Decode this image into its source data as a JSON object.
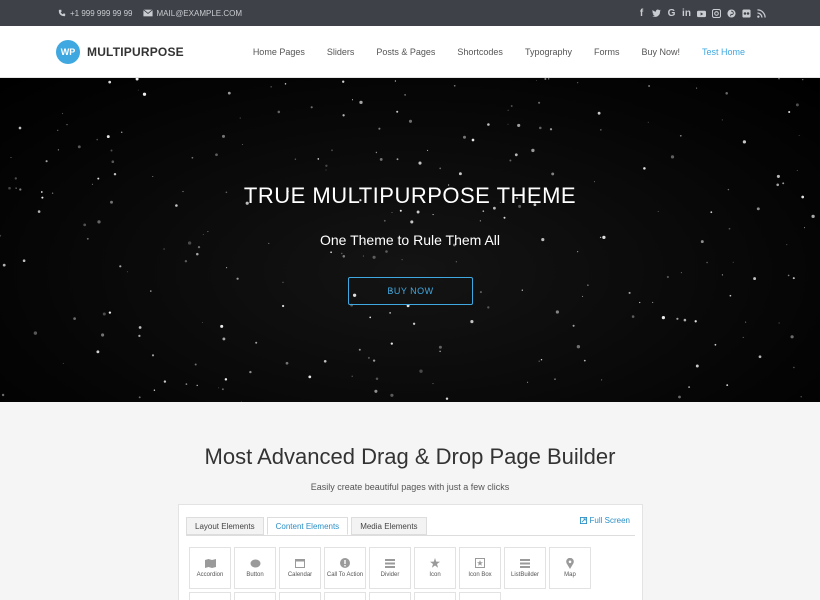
{
  "topbar": {
    "phone": "+1 999 999 99 99",
    "email": "MAIL@EXAMPLE.COM",
    "socials": [
      "facebook-icon",
      "twitter-icon",
      "google-icon",
      "linkedin-icon",
      "youtube-icon",
      "instagram-icon",
      "pinterest-icon",
      "flickr-icon",
      "rss-icon"
    ]
  },
  "header": {
    "logo_badge": "WP",
    "logo_text": "MULTIPURPOSE",
    "nav": [
      "Home Pages",
      "Sliders",
      "Posts & Pages",
      "Shortcodes",
      "Typography",
      "Forms",
      "Buy Now!",
      "Test Home"
    ],
    "active_nav": "Test Home",
    "accent": "#3fa8e0"
  },
  "hero": {
    "title": "TRUE MULTIPURPOSE THEME",
    "subtitle": "One Theme to Rule Them All",
    "button": "BUY NOW"
  },
  "section": {
    "title": "Most Advanced Drag & Drop Page Builder",
    "subtitle": "Easily create beautiful pages with just a few clicks"
  },
  "builder": {
    "tabs": [
      "Layout Elements",
      "Content Elements",
      "Media Elements"
    ],
    "active_tab": "Content Elements",
    "fullscreen": "Full Screen",
    "elements": [
      {
        "label": "Accordion",
        "icon": "accordion-icon"
      },
      {
        "label": "Button",
        "icon": "button-icon"
      },
      {
        "label": "Calendar",
        "icon": "calendar-icon"
      },
      {
        "label": "Call To Action",
        "icon": "call-to-action-icon"
      },
      {
        "label": "Divider",
        "icon": "divider-icon"
      },
      {
        "label": "Icon",
        "icon": "star-icon"
      },
      {
        "label": "Icon Box",
        "icon": "icon-box-icon"
      },
      {
        "label": "ListBuilder",
        "icon": "list-icon"
      },
      {
        "label": "Map",
        "icon": "map-pin-icon"
      }
    ]
  }
}
